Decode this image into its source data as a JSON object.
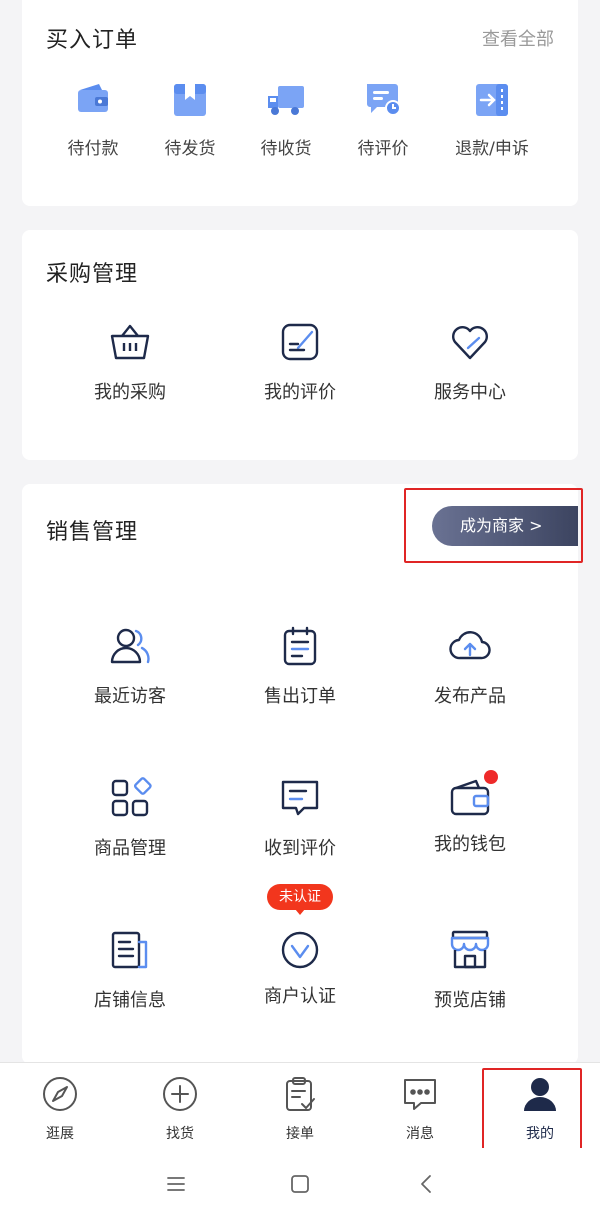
{
  "orders": {
    "title": "买入订单",
    "view_all": "查看全部",
    "items": [
      {
        "label": "待付款",
        "icon": "wallet-icon"
      },
      {
        "label": "待发货",
        "icon": "package-icon"
      },
      {
        "label": "待收货",
        "icon": "truck-icon"
      },
      {
        "label": "待评价",
        "icon": "review-chat-icon"
      },
      {
        "label": "退款/申诉",
        "icon": "refund-icon"
      }
    ]
  },
  "purchase": {
    "title": "采购管理",
    "items": [
      {
        "label": "我的采购",
        "icon": "basket-icon"
      },
      {
        "label": "我的评价",
        "icon": "edit-review-icon"
      },
      {
        "label": "服务中心",
        "icon": "heart-icon"
      }
    ]
  },
  "sales": {
    "title": "销售管理",
    "merchant_button": "成为商家 >",
    "items": [
      {
        "label": "最近访客",
        "icon": "visitors-icon"
      },
      {
        "label": "售出订单",
        "icon": "clipboard-icon"
      },
      {
        "label": "发布产品",
        "icon": "cloud-upload-icon"
      },
      {
        "label": "商品管理",
        "icon": "grid-icon"
      },
      {
        "label": "收到评价",
        "icon": "message-icon"
      },
      {
        "label": "我的钱包",
        "icon": "wallet-outline-icon"
      },
      {
        "label": "店铺信息",
        "icon": "document-icon"
      },
      {
        "label": "商户认证",
        "icon": "verify-icon"
      },
      {
        "label": "预览店铺",
        "icon": "store-icon"
      }
    ],
    "verify_badge": "未认证"
  },
  "tabbar": {
    "items": [
      {
        "label": "逛展",
        "icon": "compass-icon"
      },
      {
        "label": "找货",
        "icon": "plus-circle-icon"
      },
      {
        "label": "接单",
        "icon": "order-check-icon"
      },
      {
        "label": "消息",
        "icon": "chat-icon"
      },
      {
        "label": "我的",
        "icon": "user-icon"
      }
    ],
    "active_index": 4
  },
  "colors": {
    "accent_blue": "#5b8def",
    "navy": "#1e2a4a",
    "badge_red": "#f2361d",
    "highlight_red": "#e02525"
  }
}
